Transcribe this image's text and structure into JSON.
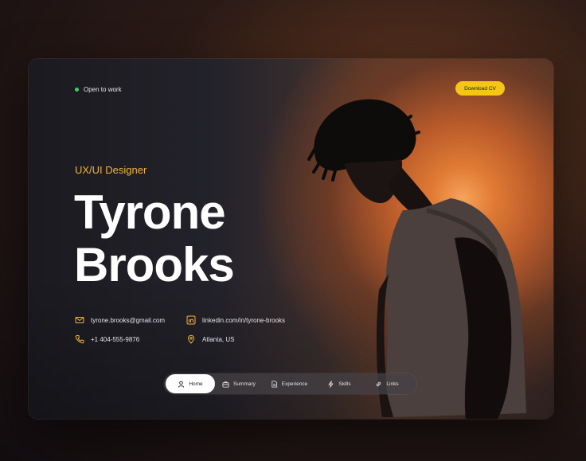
{
  "header": {
    "status_label": "Open to work",
    "download_label": "Download CV"
  },
  "hero": {
    "role": "UX/UI Designer",
    "first_name": "Tyrone",
    "last_name": "Brooks"
  },
  "contacts": {
    "email": "tyrone.brooks@gmail.com",
    "linkedin": "linkedin.com/in/tyrone-brooks",
    "phone": "+1 404-555-9876",
    "location": "Atlanta, US"
  },
  "nav": {
    "items": [
      {
        "label": "Home",
        "icon": "user-icon"
      },
      {
        "label": "Summary",
        "icon": "briefcase-icon"
      },
      {
        "label": "Experience",
        "icon": "document-icon"
      },
      {
        "label": "Skills",
        "icon": "lightning-icon"
      },
      {
        "label": "Links",
        "icon": "link-icon"
      }
    ],
    "active_index": 0
  },
  "colors": {
    "accent": "#f5c518",
    "role_color": "#f0b43a",
    "status_dot": "#35d46a",
    "background": "#1b1a20"
  }
}
